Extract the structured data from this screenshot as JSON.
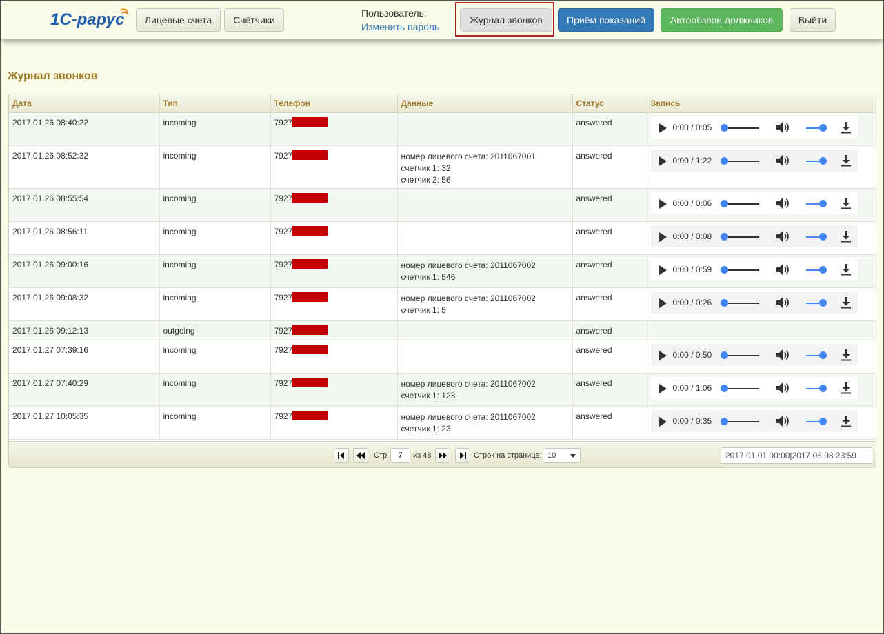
{
  "header": {
    "nav_accounts": "Лицевые счета",
    "nav_meters": "Счётчики",
    "user_label": "Пользователь:",
    "change_password": "Изменить пароль",
    "call_log": "Журнал звонков",
    "readings": "Приём показаний",
    "autodial": "Автообзвон должников",
    "logout": "Выйти"
  },
  "page_title": "Журнал звонков",
  "table": {
    "columns": [
      "Дата",
      "Тип",
      "Телефон",
      "Данные",
      "Статус",
      "Запись"
    ],
    "rows": [
      {
        "date": "2017.01.26 08:40:22",
        "type": "incoming",
        "phone": "7927",
        "data": [],
        "status": "answered",
        "duration": "0:00 / 0:05"
      },
      {
        "date": "2017.01.26 08:52:32",
        "type": "incoming",
        "phone": "7927",
        "data": [
          "номер лицевого счета: 2011067001",
          "счетчик 1: 32",
          "счетчик 2: 56"
        ],
        "status": "answered",
        "duration": "0:00 / 1:22"
      },
      {
        "date": "2017.01.26 08:55:54",
        "type": "incoming",
        "phone": "7927",
        "data": [],
        "status": "answered",
        "duration": "0:00 / 0:06"
      },
      {
        "date": "2017.01.26 08:56:11",
        "type": "incoming",
        "phone": "7927",
        "data": [],
        "status": "answered",
        "duration": "0:00 / 0:08"
      },
      {
        "date": "2017.01.26 09:00:16",
        "type": "incoming",
        "phone": "7927",
        "data": [
          "номер лицевого счета: 2011067002",
          "счетчик 1: 546"
        ],
        "status": "answered",
        "duration": "0:00 / 0:59"
      },
      {
        "date": "2017.01.26 09:08:32",
        "type": "incoming",
        "phone": "7927",
        "data": [
          "номер лицевого счета: 2011067002",
          "счетчик 1: 5"
        ],
        "status": "answered",
        "duration": "0:00 / 0:26"
      },
      {
        "date": "2017.01.26 09:12:13",
        "type": "outgoing",
        "phone": "7927",
        "data": [],
        "status": "answered",
        "duration": ""
      },
      {
        "date": "2017.01.27 07:39:16",
        "type": "incoming",
        "phone": "7927",
        "data": [],
        "status": "answered",
        "duration": "0:00 / 0:50"
      },
      {
        "date": "2017.01.27 07:40:29",
        "type": "incoming",
        "phone": "7927",
        "data": [
          "номер лицевого счета: 2011067002",
          "счетчик 1: 123"
        ],
        "status": "answered",
        "duration": "0:00 / 1:06"
      },
      {
        "date": "2017.01.27 10:05:35",
        "type": "incoming",
        "phone": "7927",
        "data": [
          "номер лицевого счета: 2011067002",
          "счетчик 1: 23"
        ],
        "status": "answered",
        "duration": "0:00 / 0:35"
      }
    ]
  },
  "pager": {
    "page_label": "Стр.",
    "page_value": "7",
    "of_label": "из 48",
    "rows_label": "Строк на странице:",
    "rows_value": "10",
    "date_range": "2017.01.01 00:00|2017.06.08 23:59"
  },
  "colors": {
    "accent_title": "#9e7a2a",
    "primary": "#337ab7",
    "success": "#5cb85c",
    "redaction": "#c00000",
    "highlight_border": "#b22222"
  },
  "icons": [
    "logo-1c-rarus",
    "play-icon",
    "volume-icon",
    "download-icon",
    "first-page-icon",
    "prev-page-icon",
    "next-page-icon",
    "last-page-icon",
    "caret-down-icon"
  ]
}
